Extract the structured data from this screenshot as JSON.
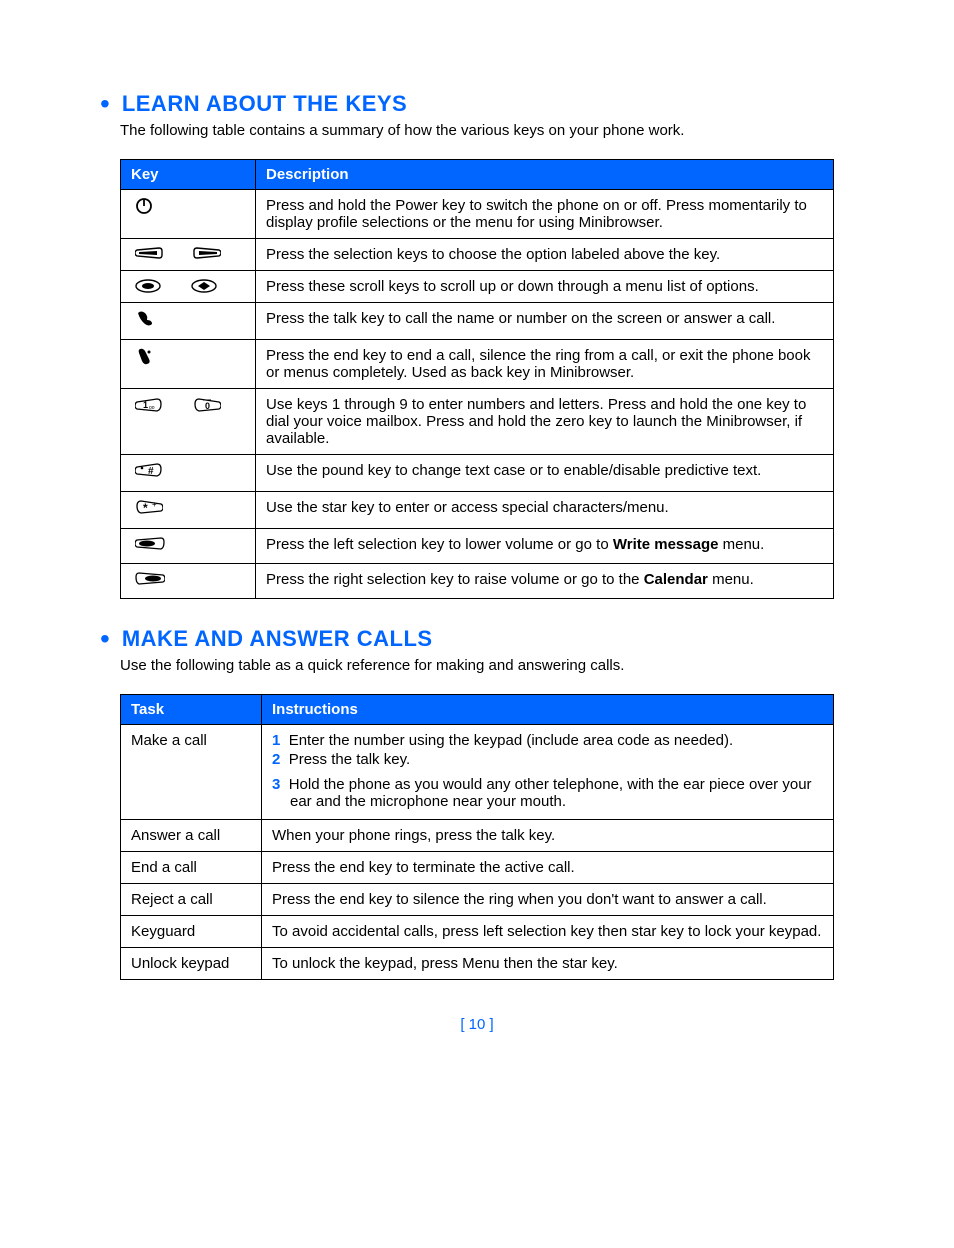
{
  "section1": {
    "title": "LEARN ABOUT THE KEYS",
    "intro": "The following table contains a summary of how the various keys on your phone work.",
    "headers": {
      "col1": "Key",
      "col2": "Description"
    },
    "rows": [
      {
        "icon": "power-icon",
        "desc": "Press and hold the Power key to switch the phone on or off. Press momentarily to display profile selections or the menu for using Minibrowser."
      },
      {
        "icon": "selection-keys-icon",
        "desc": "Press the selection keys to choose the option labeled above the key."
      },
      {
        "icon": "scroll-keys-icon",
        "desc": "Press these scroll keys to scroll up or down through a menu list of options."
      },
      {
        "icon": "talk-icon",
        "desc": "Press the talk key to call the name or number on the screen or answer a call."
      },
      {
        "icon": "end-icon",
        "desc": "Press the end key to end a call, silence the ring from a call, or exit the phone book or menus completely. Used as back key in Minibrowser."
      },
      {
        "icon": "number-keys-icon",
        "desc": "Use keys 1 through 9 to enter numbers and letters. Press and hold the one key to dial your voice mailbox. Press and hold the zero key to launch the Minibrowser, if available."
      },
      {
        "icon": "pound-icon",
        "desc": "Use the pound key to change text case or to enable/disable predictive text."
      },
      {
        "icon": "star-icon",
        "desc": "Use the star key to enter or access special characters/menu."
      },
      {
        "icon": "left-select-icon",
        "desc_pre": "Press the left selection key to lower volume or go to ",
        "desc_bold": "Write message",
        "desc_post": " menu."
      },
      {
        "icon": "right-select-icon",
        "desc_pre": "Press the right selection key to raise volume or go to the ",
        "desc_bold": "Calendar",
        "desc_post": " menu."
      }
    ]
  },
  "section2": {
    "title": "MAKE AND ANSWER CALLS",
    "intro": "Use the following table as a quick reference for making and answering calls.",
    "headers": {
      "col1": "Task",
      "col2": "Instructions"
    },
    "rows": [
      {
        "task": "Make a call",
        "steps": [
          "Enter the number using the keypad (include area code as needed).",
          "Press the talk key.",
          "Hold the phone as you would any other telephone, with the ear piece over your ear and the microphone near your mouth."
        ]
      },
      {
        "task": "Answer a call",
        "instr": "When your phone rings, press the talk key."
      },
      {
        "task": "End a call",
        "instr": "Press the end key to terminate the active call."
      },
      {
        "task": "Reject a call",
        "instr": "Press the end key to silence the ring when you don't want to answer a call."
      },
      {
        "task": "Keyguard",
        "instr": "To avoid accidental calls, press left selection key then star key to lock your keypad."
      },
      {
        "task": "Unlock keypad",
        "instr": "To unlock the keypad, press Menu then the star key."
      }
    ]
  },
  "page_number": "[ 10 ]"
}
